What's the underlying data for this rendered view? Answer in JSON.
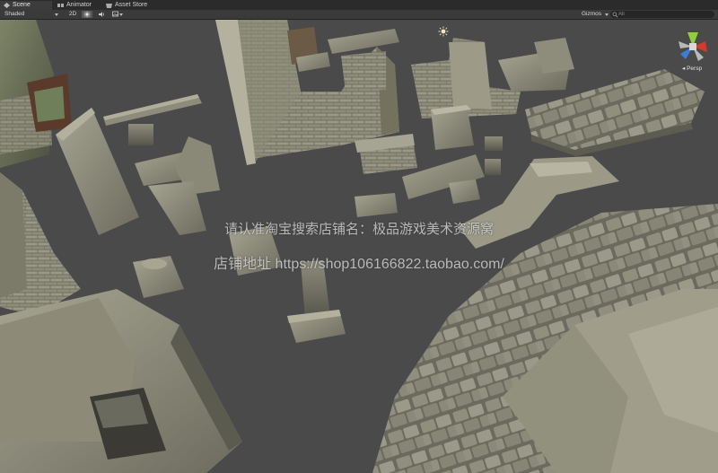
{
  "tabs": [
    {
      "label": "Scene",
      "icon": "scene-icon"
    },
    {
      "label": "Animator",
      "icon": "animator-icon"
    },
    {
      "label": "Asset Store",
      "icon": "asset-store-icon"
    }
  ],
  "toolbar": {
    "shading_mode": "Shaded",
    "view_2d": "2D",
    "gizmos_label": "Gizmos",
    "search_placeholder": "All"
  },
  "scene_gizmo": {
    "projection": "Persp",
    "colors": {
      "x": "#d23a2a",
      "y": "#8fd13c",
      "z": "#3b7ed8"
    }
  },
  "watermark": {
    "line1": "请认准淘宝搜索店铺名：极品游戏美术资源窝",
    "line2": "店铺地址 https://shop106166822.taobao.com/"
  },
  "colors": {
    "viewport_bg": "#4a4a4a",
    "tab_bar_bg": "#2b2b2b",
    "toolbar_bg": "#3a3a3a",
    "stone_light": "#9a9a86",
    "stone_dark": "#5f5d52"
  }
}
